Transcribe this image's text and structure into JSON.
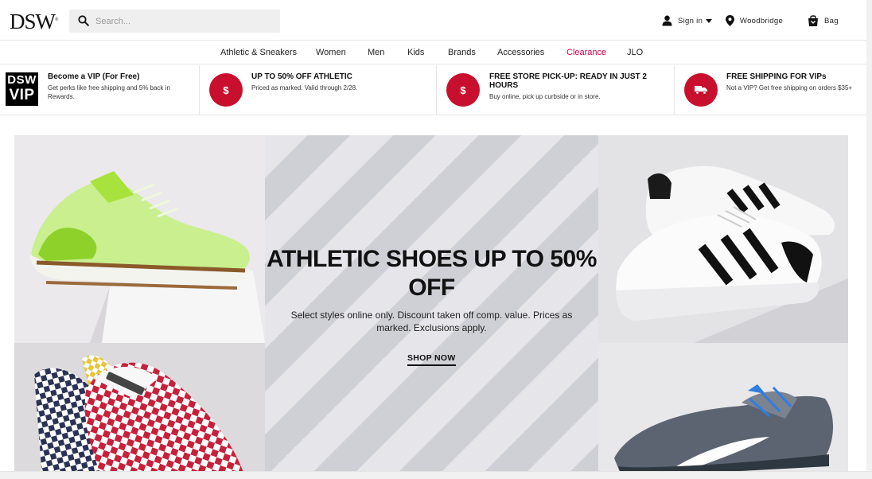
{
  "header": {
    "logo": "DSW",
    "search_placeholder": "Search...",
    "sign_in": "Sign in",
    "store": "Woodbridge",
    "bag": "Bag"
  },
  "nav": {
    "items": [
      "Athletic & Sneakers",
      "Women",
      "Men",
      "Kids",
      "Brands",
      "Accessories",
      "Clearance",
      "JLO"
    ]
  },
  "promos": [
    {
      "badge_line1": "DSW",
      "badge_line2": "VIP",
      "title": "Become a VIP (For Free)",
      "desc": "Get perks like free shipping and 5% back in Rewards."
    },
    {
      "badge": "$",
      "title": "UP TO 50% OFF ATHLETIC",
      "desc": "Priced as marked. Valid through 2/28."
    },
    {
      "badge": "$",
      "title": "FREE STORE PICK-UP: READY IN JUST 2 HOURS",
      "desc": "Buy online, pick up curbside or in store."
    },
    {
      "title": "FREE SHIPPING FOR VIPs",
      "desc": "Not a VIP? Get free shipping on orders $35+"
    }
  ],
  "hero": {
    "headline": "ATHLETIC SHOES UP TO 50% OFF",
    "sub": "Select styles online only. Discount taken off comp. value. Prices as marked. Exclusions apply.",
    "cta": "SHOP NOW"
  },
  "colors": {
    "accent_red": "#c8102e",
    "clearance": "#d3004c"
  }
}
